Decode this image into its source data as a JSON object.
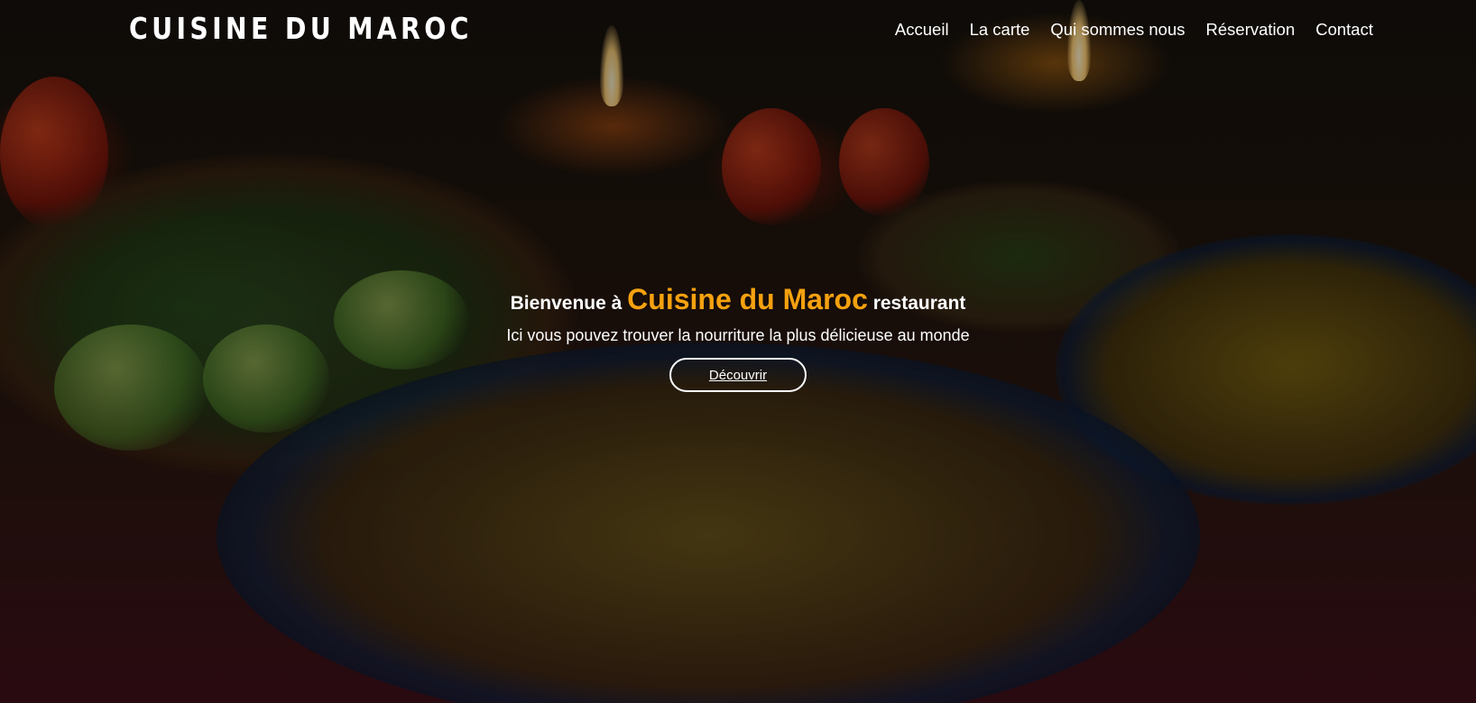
{
  "header": {
    "brand": "CUISINE DU MAROC",
    "nav": [
      {
        "label": "Accueil"
      },
      {
        "label": "La carte"
      },
      {
        "label": "Qui sommes nous"
      },
      {
        "label": "Réservation"
      },
      {
        "label": "Contact"
      }
    ]
  },
  "hero": {
    "title_prefix": "Bienvenue à",
    "title_highlight": "Cuisine du Maroc",
    "title_suffix": "restaurant",
    "subtitle": "Ici vous pouvez trouver la nourriture la plus délicieuse au monde",
    "cta_label": "Découvrir",
    "background_image": "moroccan-food-spread",
    "colors": {
      "accent": "#f5a10f",
      "text": "#ffffff"
    }
  }
}
